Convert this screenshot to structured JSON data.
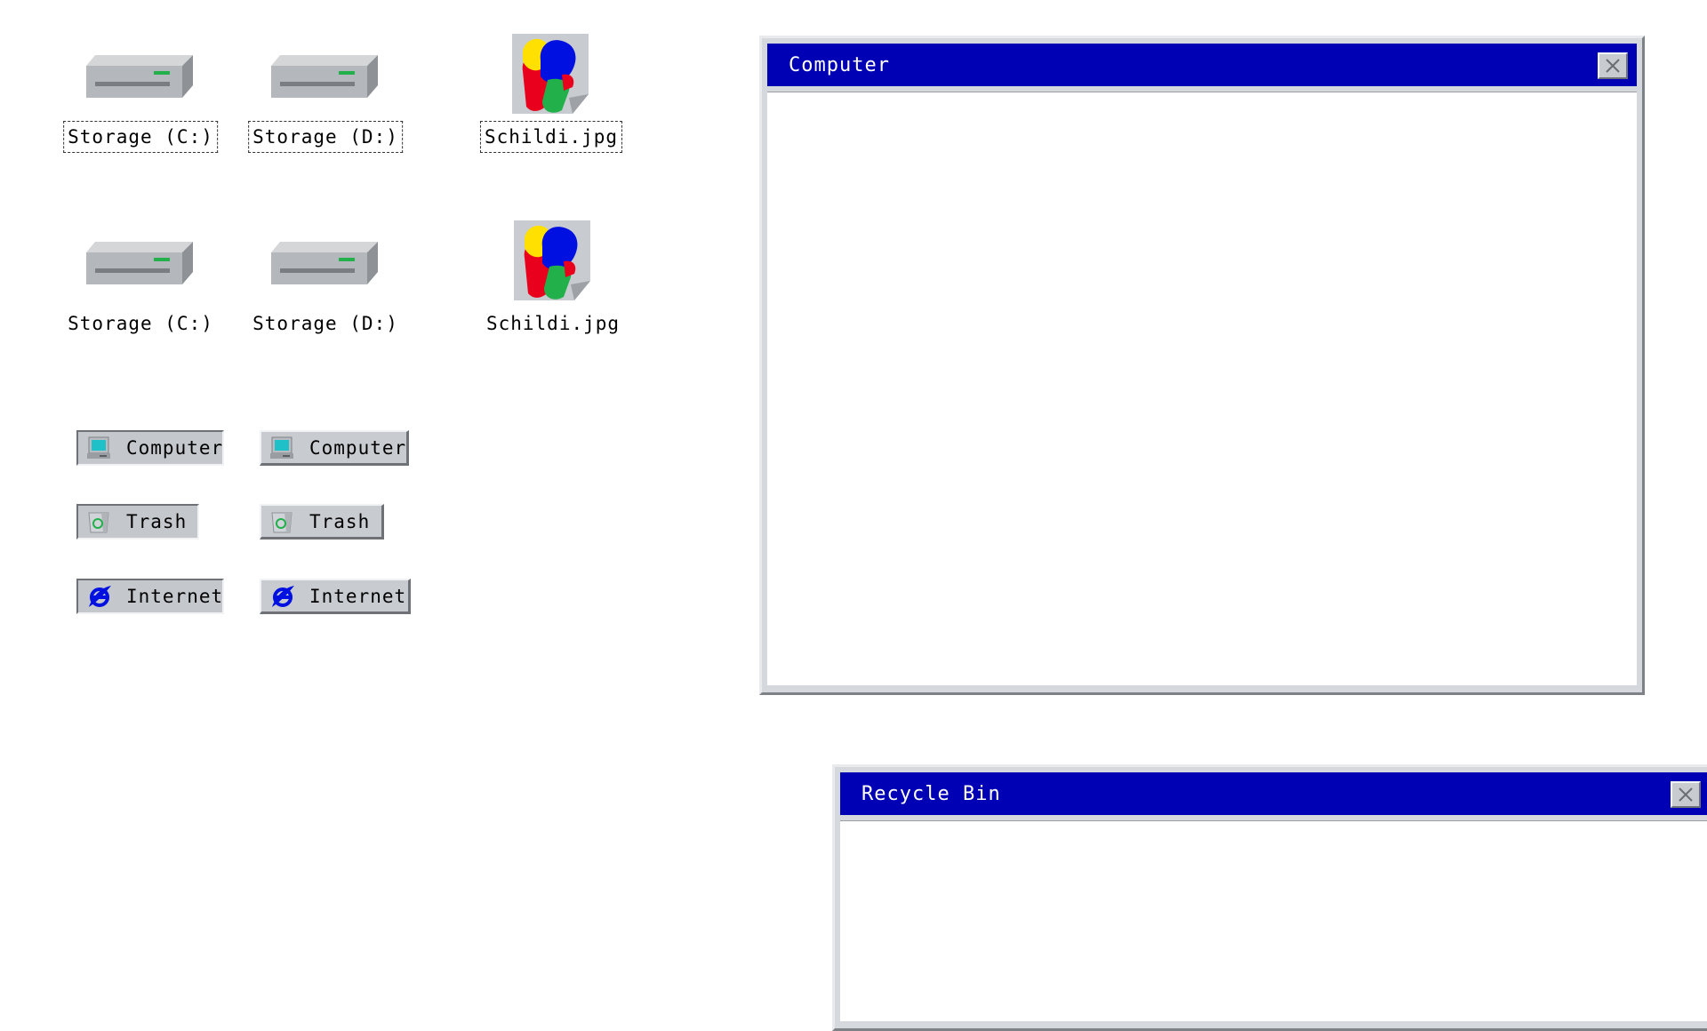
{
  "desktop": {
    "icons": [
      {
        "label": "Storage (C:)",
        "icon": "drive-icon",
        "selected": true
      },
      {
        "label": "Storage (D:)",
        "icon": "drive-icon",
        "selected": true
      },
      {
        "label": "Schildi.jpg",
        "icon": "image-file-icon",
        "selected": true
      },
      {
        "label": "Storage (C:)",
        "icon": "drive-icon",
        "selected": false
      },
      {
        "label": "Storage (D:)",
        "icon": "drive-icon",
        "selected": false
      },
      {
        "label": "Schildi.jpg",
        "icon": "image-file-icon",
        "selected": false
      }
    ]
  },
  "taskbar": {
    "buttons": [
      {
        "label": "Computer",
        "icon": "computer-icon",
        "pressed": true
      },
      {
        "label": "Computer",
        "icon": "computer-icon",
        "pressed": false
      },
      {
        "label": "Trash",
        "icon": "recycle-bin-icon",
        "pressed": true
      },
      {
        "label": "Trash",
        "icon": "recycle-bin-icon",
        "pressed": false
      },
      {
        "label": "Internet",
        "icon": "internet-icon",
        "pressed": true
      },
      {
        "label": "Internet",
        "icon": "internet-icon",
        "pressed": false
      }
    ]
  },
  "windows": {
    "computer": {
      "title": "Computer",
      "close_icon": "close-icon"
    },
    "recycle_bin": {
      "title": "Recycle Bin",
      "close_icon": "close-icon"
    }
  },
  "colors": {
    "title_bar": "#0000b4",
    "window_frame": "#d5d9dd",
    "desktop": "#ffffff"
  }
}
